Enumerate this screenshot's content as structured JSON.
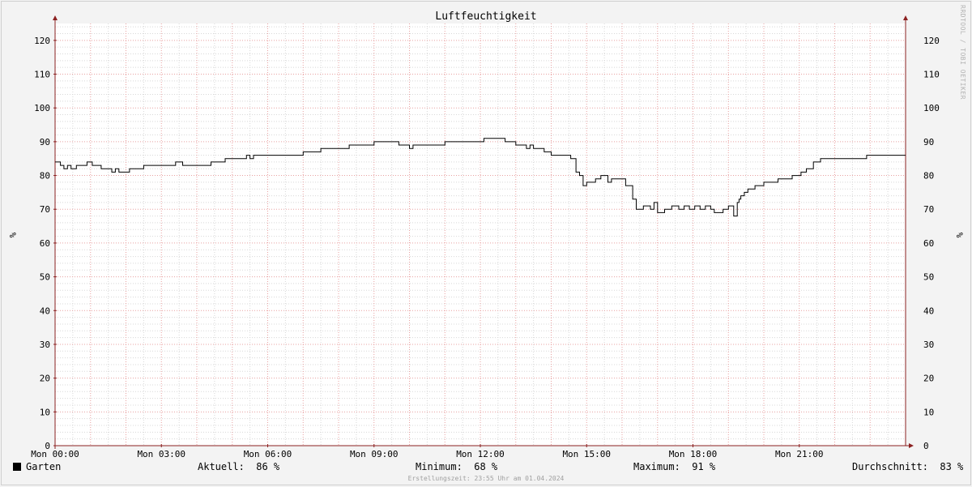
{
  "chart_data": {
    "type": "line",
    "title": "Luftfeuchtigkeit",
    "ylabel_left": "%",
    "ylabel_right": "%",
    "ylim": [
      0,
      125
    ],
    "yticks": [
      0,
      10,
      20,
      30,
      40,
      50,
      60,
      70,
      80,
      90,
      100,
      110,
      120
    ],
    "xlim_hours": [
      0,
      24
    ],
    "xtick_labels": [
      "Mon 00:00",
      "Mon 03:00",
      "Mon 06:00",
      "Mon 09:00",
      "Mon 12:00",
      "Mon 15:00",
      "Mon 18:00",
      "Mon 21:00"
    ],
    "xtick_hours": [
      0,
      3,
      6,
      9,
      12,
      15,
      18,
      21
    ],
    "grid": true,
    "series": [
      {
        "name": "Garten",
        "color": "#000000",
        "x": [
          0,
          0.15,
          0.25,
          0.35,
          0.45,
          0.6,
          0.9,
          1.05,
          1.3,
          1.6,
          1.7,
          1.8,
          2.1,
          2.5,
          3.1,
          3.4,
          3.6,
          4.1,
          4.4,
          4.8,
          5.2,
          5.4,
          5.5,
          5.6,
          6.0,
          6.5,
          7.0,
          7.5,
          8.3,
          9.0,
          9.7,
          10.0,
          10.1,
          10.3,
          10.5,
          11.0,
          11.5,
          12.1,
          12.7,
          13.0,
          13.3,
          13.4,
          13.5,
          13.8,
          14.0,
          14.3,
          14.55,
          14.7,
          14.8,
          14.9,
          15.0,
          15.25,
          15.4,
          15.6,
          15.7,
          15.85,
          16.1,
          16.3,
          16.4,
          16.6,
          16.8,
          16.9,
          17.0,
          17.2,
          17.4,
          17.6,
          17.75,
          17.9,
          18.05,
          18.2,
          18.35,
          18.5,
          18.6,
          18.85,
          19.0,
          19.15,
          19.25,
          19.3,
          19.35,
          19.45,
          19.55,
          19.75,
          20.0,
          20.4,
          20.8,
          21.0,
          21.05,
          21.2,
          21.4,
          21.6,
          22.0,
          22.5,
          22.9,
          24.0
        ],
        "y": [
          84,
          83,
          82,
          83,
          82,
          83,
          84,
          83,
          82,
          81,
          82,
          81,
          82,
          83,
          83,
          84,
          83,
          83,
          84,
          85,
          85,
          86,
          85,
          86,
          86,
          86,
          87,
          88,
          89,
          90,
          89,
          88,
          89,
          89,
          89,
          90,
          90,
          91,
          90,
          89,
          88,
          89,
          88,
          87,
          86,
          86,
          85,
          81,
          80,
          77,
          78,
          79,
          80,
          78,
          79,
          79,
          77,
          73,
          70,
          71,
          70,
          72,
          69,
          70,
          71,
          70,
          71,
          70,
          71,
          70,
          71,
          70,
          69,
          70,
          71,
          68,
          72,
          73,
          74,
          75,
          76,
          77,
          78,
          79,
          80,
          80,
          81,
          82,
          84,
          85,
          85,
          85,
          86,
          86
        ]
      }
    ]
  },
  "legend": {
    "series_name": "Garten",
    "aktuell_label": "Aktuell:",
    "aktuell_value": "86 %",
    "minimum_label": "Minimum:",
    "minimum_value": "68 %",
    "maximum_label": "Maximum:",
    "maximum_value": "91 %",
    "durchschnitt_label": "Durchschnitt:",
    "durchschnitt_value": "83 %"
  },
  "footer_text": "Erstellungszeit: 23:55 Uhr am 01.04.2024",
  "watermark": "RRDTOOL / TOBI OETIKER",
  "colors": {
    "background": "#f3f3f3",
    "plot_background": "#ffffff",
    "major_grid": "#e8a0a0",
    "minor_grid": "#d8d8d8",
    "axis": "#8b2020",
    "line": "#000000"
  }
}
